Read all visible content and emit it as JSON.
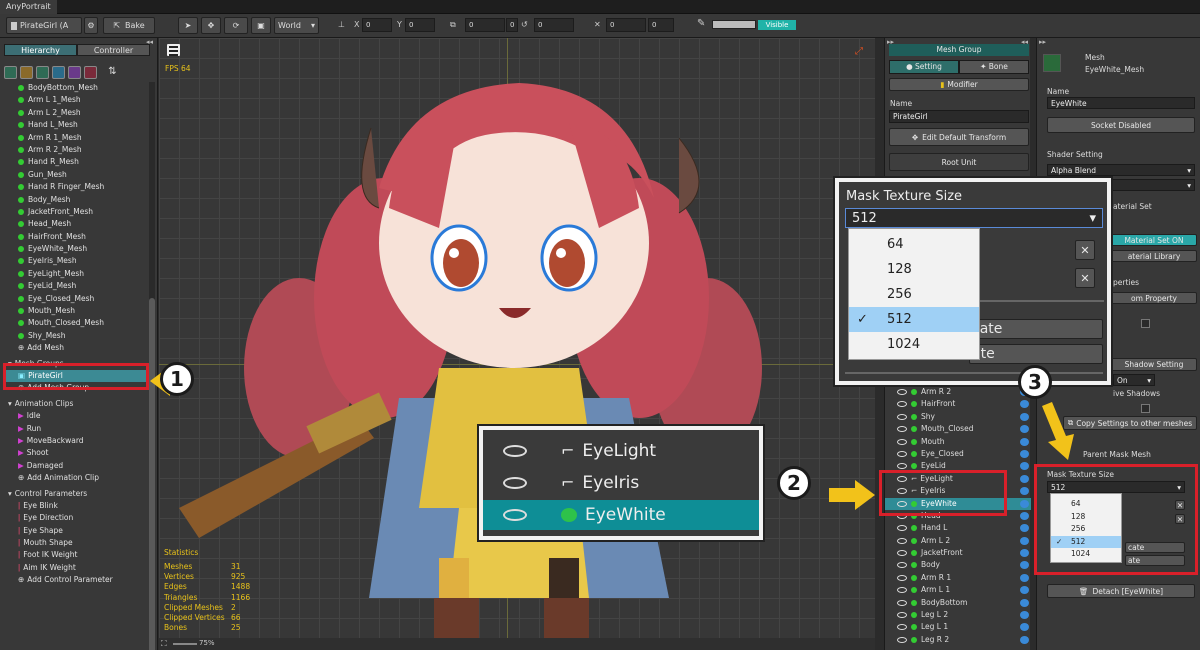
{
  "window": {
    "tab_title": "AnyPortrait"
  },
  "toolbar": {
    "object_name": "PirateGirl (A",
    "bake_label": "Bake",
    "space_value": "World",
    "x_label": "X",
    "x_value": "0",
    "y_label": "Y",
    "y_value": "0",
    "scale_x": "0",
    "scale_y": "0",
    "rot_value": "0",
    "size_x": "0",
    "size_y": "0",
    "visible_label": "Visible"
  },
  "left_panel": {
    "tabs": [
      "Hierarchy",
      "Controller"
    ],
    "meshes": [
      "BodyBottom_Mesh",
      "Arm L 1_Mesh",
      "Arm L 2_Mesh",
      "Hand L_Mesh",
      "Arm R 1_Mesh",
      "Arm R 2_Mesh",
      "Hand R_Mesh",
      "Gun_Mesh",
      "Hand R Finger_Mesh",
      "Body_Mesh",
      "JacketFront_Mesh",
      "Head_Mesh",
      "HairFront_Mesh",
      "EyeWhite_Mesh",
      "EyeIris_Mesh",
      "EyeLight_Mesh",
      "EyeLid_Mesh",
      "Eye_Closed_Mesh",
      "Mouth_Mesh",
      "Mouth_Closed_Mesh",
      "Shy_Mesh"
    ],
    "add_mesh": "Add Mesh",
    "mesh_groups_header": "Mesh Groups",
    "mesh_group_selected": "PirateGirl",
    "add_mesh_group": "Add Mesh Group",
    "animation_header": "Animation Clips",
    "animations": [
      "Idle",
      "Run",
      "MoveBackward",
      "Shoot",
      "Damaged"
    ],
    "add_animation": "Add Animation Clip",
    "control_header": "Control Parameters",
    "controls": [
      "Eye Blink",
      "Eye Direction",
      "Eye Shape",
      "Mouth Shape",
      "Foot IK Weight",
      "Aim IK Weight"
    ],
    "add_control": "Add Control Parameter"
  },
  "viewport": {
    "fps": "FPS 64",
    "zoom": "75%",
    "statistics_title": "Statistics",
    "stats": [
      {
        "label": "Meshes",
        "value": "31"
      },
      {
        "label": "Vertices",
        "value": "925"
      },
      {
        "label": "Edges",
        "value": "1488"
      },
      {
        "label": "Triangles",
        "value": "1166"
      },
      {
        "label": "Clipped Meshes",
        "value": "2"
      },
      {
        "label": "Clipped Vertices",
        "value": "66"
      },
      {
        "label": "Bones",
        "value": "25"
      }
    ]
  },
  "zoom_layers": [
    "EyeLight",
    "EyeIris",
    "EyeWhite"
  ],
  "mid_panel": {
    "title": "Mesh Group",
    "tab_setting": "Setting",
    "tab_bone": "Bone",
    "modifier": "Modifier",
    "name_label": "Name",
    "name_value": "PirateGirl",
    "edit_transform": "Edit Default Transform",
    "root_unit": "Root Unit",
    "layers": [
      "Arm R 2",
      "HairFront",
      "Shy",
      "Mouth_Closed",
      "Mouth",
      "Eye_Closed",
      "EyeLid",
      "EyeLight",
      "EyeIris",
      "EyeWhite",
      "Head",
      "Hand L",
      "Arm L 2",
      "JacketFront",
      "Body",
      "Arm R 1",
      "Arm L 1",
      "BodyBottom",
      "Leg L 2",
      "Leg L 1",
      "Leg R 2"
    ]
  },
  "right_panel": {
    "mesh_type": "Mesh",
    "mesh_name": "EyeWhite_Mesh",
    "name_label": "Name",
    "name_value": "EyeWhite",
    "socket_disabled": "Socket Disabled",
    "shader_setting": "Shader Setting",
    "shader_value": "Alpha Blend",
    "material_set_partial": "aterial Set",
    "material_set_on_partial": "Material Set ON",
    "material_library_partial": "aterial Library",
    "properties_partial": "perties",
    "custom_property_partial": "om Property",
    "shadow_setting_partial": "Shadow Setting",
    "shadow_value": "On",
    "receive_shadows_partial": "ive Shadows",
    "copy_settings": "Copy Settings to other meshes",
    "parent_mask_mesh": "Parent Mask Mesh",
    "mask_texture_size": "Mask Texture Size",
    "mask_value": "512",
    "mask_options": [
      "64",
      "128",
      "256",
      "512",
      "1024"
    ],
    "detach": "Detach [EyeWhite]",
    "duplicate_partial": "cate",
    "remove_partial": "ate"
  },
  "zoom_callout": {
    "title": "Mask Texture Size",
    "value": "512",
    "options": [
      "64",
      "128",
      "256",
      "512",
      "1024"
    ],
    "btn1_partial": "cate",
    "btn2_partial": "ate"
  },
  "badges": [
    "1",
    "2",
    "3"
  ],
  "colors": {
    "accent": "#3c8a94",
    "highlight_red": "#d9202a",
    "arrow_yellow": "#f2c21a",
    "stats_yellow": "#e8c21a",
    "visible_teal": "#20b3a8"
  }
}
